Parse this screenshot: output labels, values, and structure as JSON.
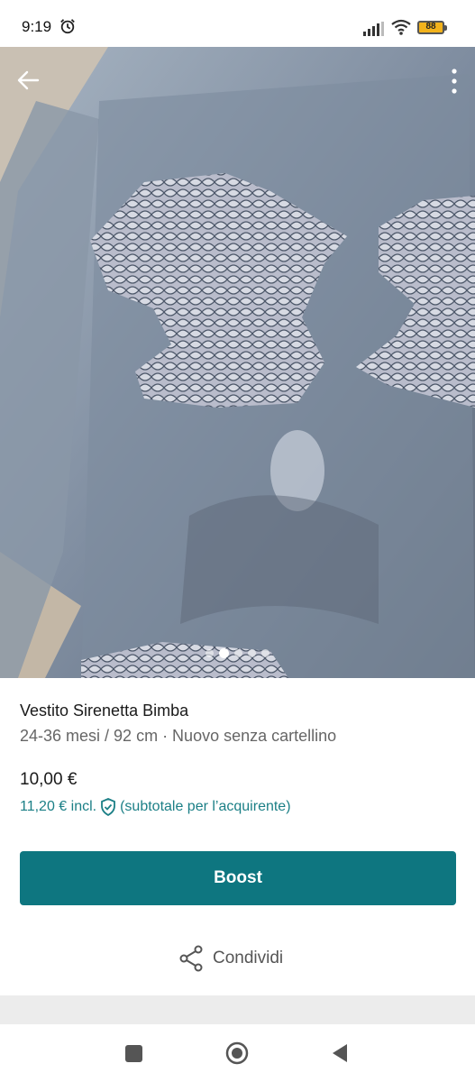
{
  "status_bar": {
    "time": "9:19",
    "battery": "88"
  },
  "photo": {
    "dot_count": 5,
    "active_dot": 1
  },
  "listing": {
    "title": "Vestito Sirenetta Bimba",
    "subtitle": "24-36 mesi / 92 cm · Nuovo senza cartellino",
    "price": "10,00 €",
    "price_incl": "11,20 € incl.",
    "price_note": "(subtotale per l’acquirente)"
  },
  "actions": {
    "boost_label": "Boost",
    "share_label": "Condividi"
  },
  "colors": {
    "accent": "#0e7680",
    "accent_text": "#1b7f86"
  },
  "icons": [
    "alarm-icon",
    "signal-icon",
    "wifi-icon",
    "battery-icon",
    "back-arrow-icon",
    "more-vert-icon",
    "shield-check-icon",
    "share-icon",
    "recent-apps-icon",
    "home-icon",
    "nav-back-icon"
  ]
}
